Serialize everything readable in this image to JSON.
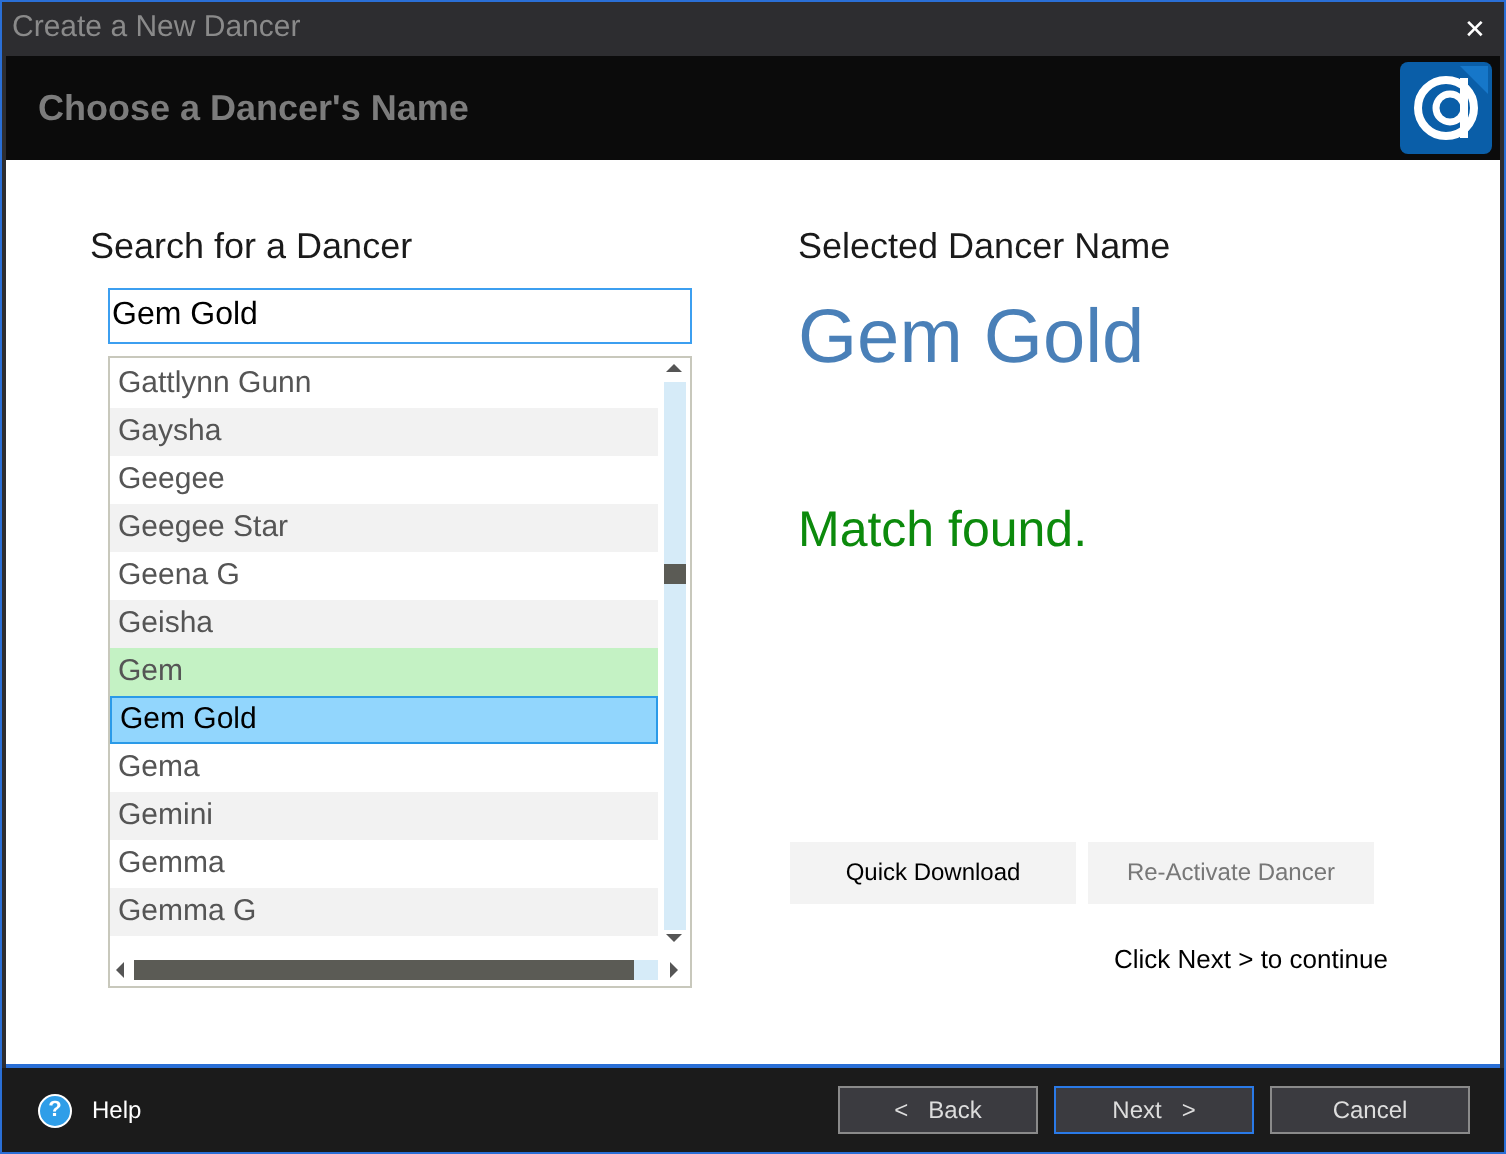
{
  "window": {
    "title": "Create a New Dancer",
    "close": "✕"
  },
  "header": {
    "title": "Choose a Dancer's Name"
  },
  "search": {
    "label": "Search for a Dancer",
    "value": "Gem Gold"
  },
  "list": [
    {
      "name": "Gattlynn Gunn",
      "selected": false,
      "matched": false
    },
    {
      "name": "Gaysha",
      "selected": false,
      "matched": false
    },
    {
      "name": "Geegee",
      "selected": false,
      "matched": false
    },
    {
      "name": "Geegee Star",
      "selected": false,
      "matched": false
    },
    {
      "name": "Geena G",
      "selected": false,
      "matched": false
    },
    {
      "name": "Geisha",
      "selected": false,
      "matched": false
    },
    {
      "name": "Gem",
      "selected": false,
      "matched": true
    },
    {
      "name": "Gem Gold",
      "selected": true,
      "matched": false
    },
    {
      "name": "Gema",
      "selected": false,
      "matched": false
    },
    {
      "name": "Gemini",
      "selected": false,
      "matched": false
    },
    {
      "name": "Gemma",
      "selected": false,
      "matched": false
    },
    {
      "name": "Gemma G",
      "selected": false,
      "matched": false
    }
  ],
  "selected_panel": {
    "label": "Selected Dancer Name",
    "name": "Gem Gold",
    "status": "Match found."
  },
  "actions": [
    {
      "label": "Quick Download",
      "disabled": false
    },
    {
      "label": "Re-Activate Dancer",
      "disabled": true
    }
  ],
  "hint": "Click Next > to continue",
  "footer": {
    "help": "Help",
    "help_icon": "?",
    "buttons": [
      {
        "label": "<   Back",
        "focused": false
      },
      {
        "label": "Next   >",
        "focused": true
      },
      {
        "label": "Cancel",
        "focused": false
      }
    ]
  }
}
